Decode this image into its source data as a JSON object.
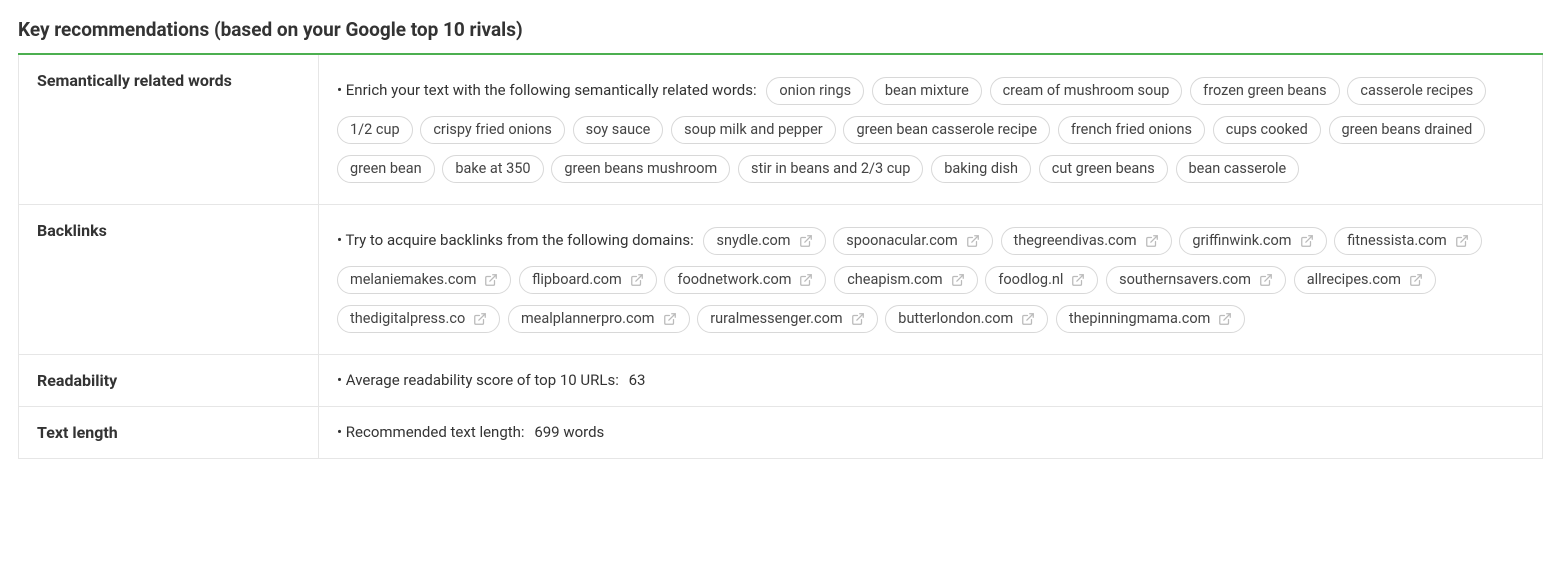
{
  "title": "Key recommendations (based on your Google top 10 rivals)",
  "rows": {
    "semantic": {
      "label": "Semantically related words",
      "intro": "• Enrich your text with the following semantically related words:",
      "pills": [
        "onion rings",
        "bean mixture",
        "cream of mushroom soup",
        "frozen green beans",
        "casserole recipes",
        "1/2 cup",
        "crispy fried onions",
        "soy sauce",
        "soup milk and pepper",
        "green bean casserole recipe",
        "french fried onions",
        "cups cooked",
        "green beans drained",
        "green bean",
        "bake at 350",
        "green beans mushroom",
        "stir in beans and 2/3 cup",
        "baking dish",
        "cut green beans",
        "bean casserole"
      ]
    },
    "backlinks": {
      "label": "Backlinks",
      "intro": "• Try to acquire backlinks from the following domains:",
      "pills": [
        "snydle.com",
        "spoonacular.com",
        "thegreendivas.com",
        "griffinwink.com",
        "fitnessista.com",
        "melaniemakes.com",
        "flipboard.com",
        "foodnetwork.com",
        "cheapism.com",
        "foodlog.nl",
        "southernsavers.com",
        "allrecipes.com",
        "thedigitalpress.co",
        "mealplannerpro.com",
        "ruralmessenger.com",
        "butterlondon.com",
        "thepinningmama.com"
      ]
    },
    "readability": {
      "label": "Readability",
      "line": "• Average readability score of top 10 URLs:",
      "value": "63"
    },
    "textlength": {
      "label": "Text length",
      "line": "• Recommended text length:",
      "value": "699 words"
    }
  }
}
